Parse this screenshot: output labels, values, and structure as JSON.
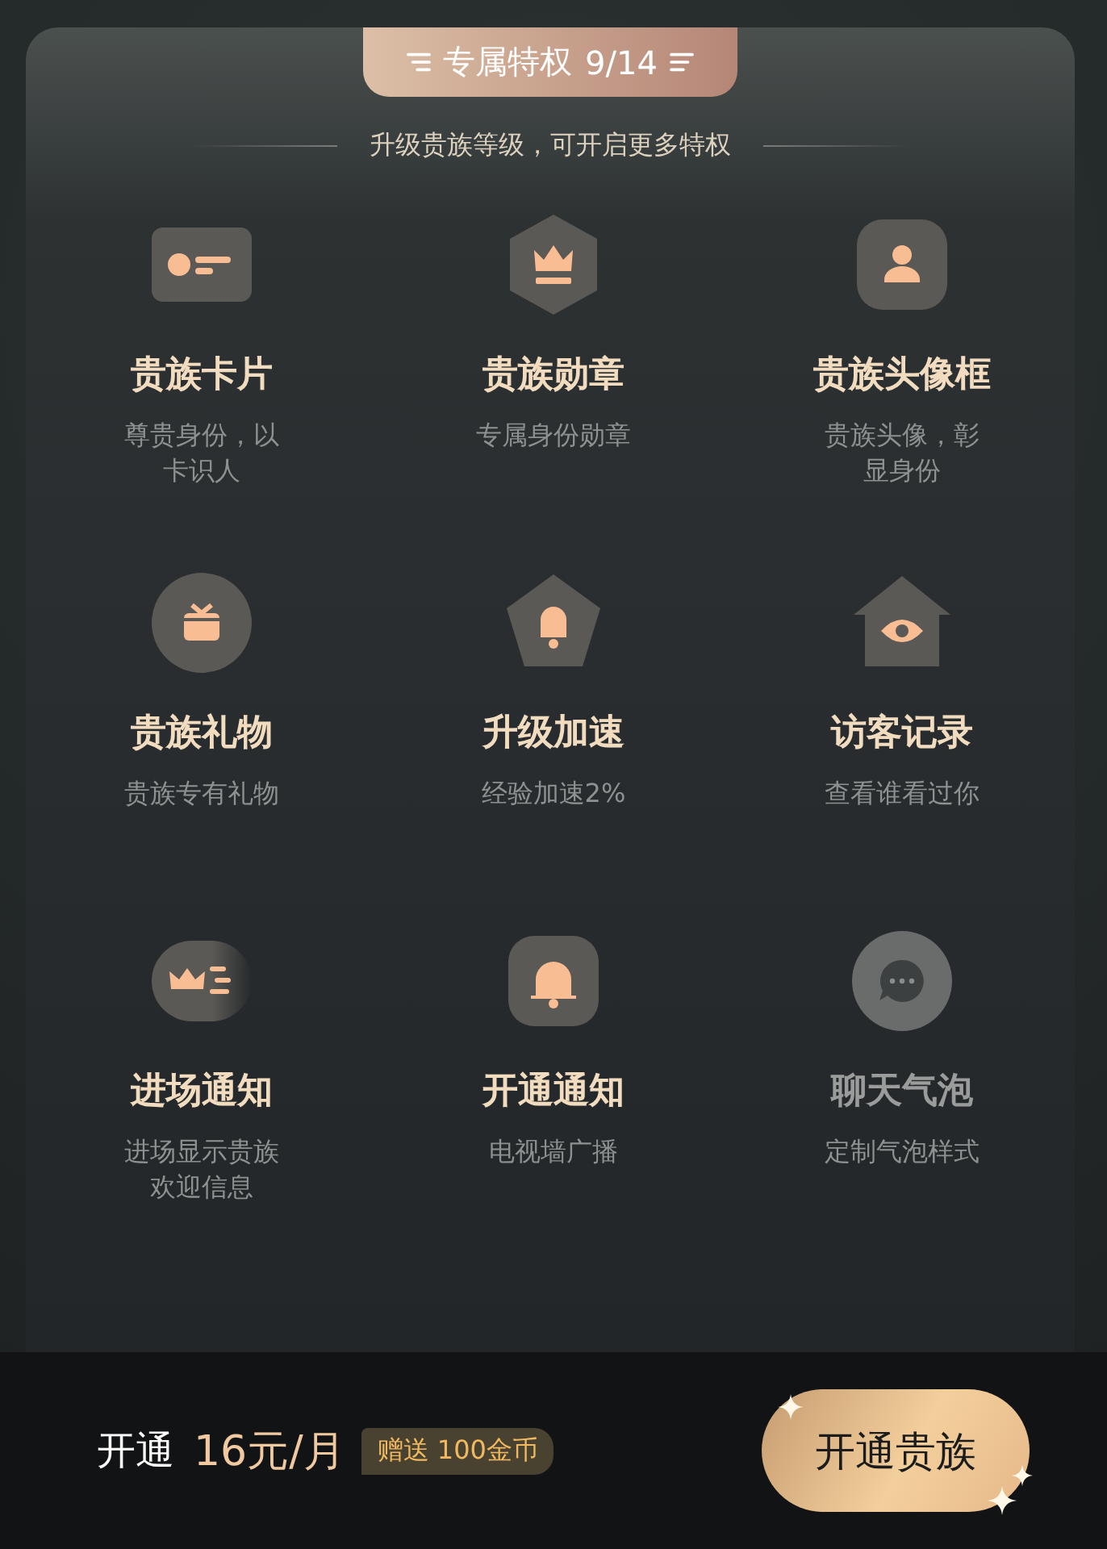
{
  "header": {
    "title": "专属特权",
    "count": "9/14",
    "subtitle": "升级贵族等级，可开启更多特权"
  },
  "perks": [
    {
      "title": "贵族卡片",
      "desc": "尊贵身份，以卡识人",
      "locked": false
    },
    {
      "title": "贵族勋章",
      "desc": "专属身份勋章",
      "locked": false
    },
    {
      "title": "贵族头像框",
      "desc": "贵族头像，彰显身份",
      "locked": false
    },
    {
      "title": "贵族礼物",
      "desc": "贵族专有礼物",
      "locked": false
    },
    {
      "title": "升级加速",
      "desc": "经验加速2%",
      "locked": false
    },
    {
      "title": "访客记录",
      "desc": "查看谁看过你",
      "locked": false
    },
    {
      "title": "进场通知",
      "desc": "进场显示贵族欢迎信息",
      "locked": false
    },
    {
      "title": "开通通知",
      "desc": "电视墙广播",
      "locked": false
    },
    {
      "title": "聊天气泡",
      "desc": "定制气泡样式",
      "locked": true
    }
  ],
  "footer": {
    "label": "开通",
    "price": "16元/月",
    "bonus": "赠送 100金币",
    "button": "开通贵族"
  }
}
